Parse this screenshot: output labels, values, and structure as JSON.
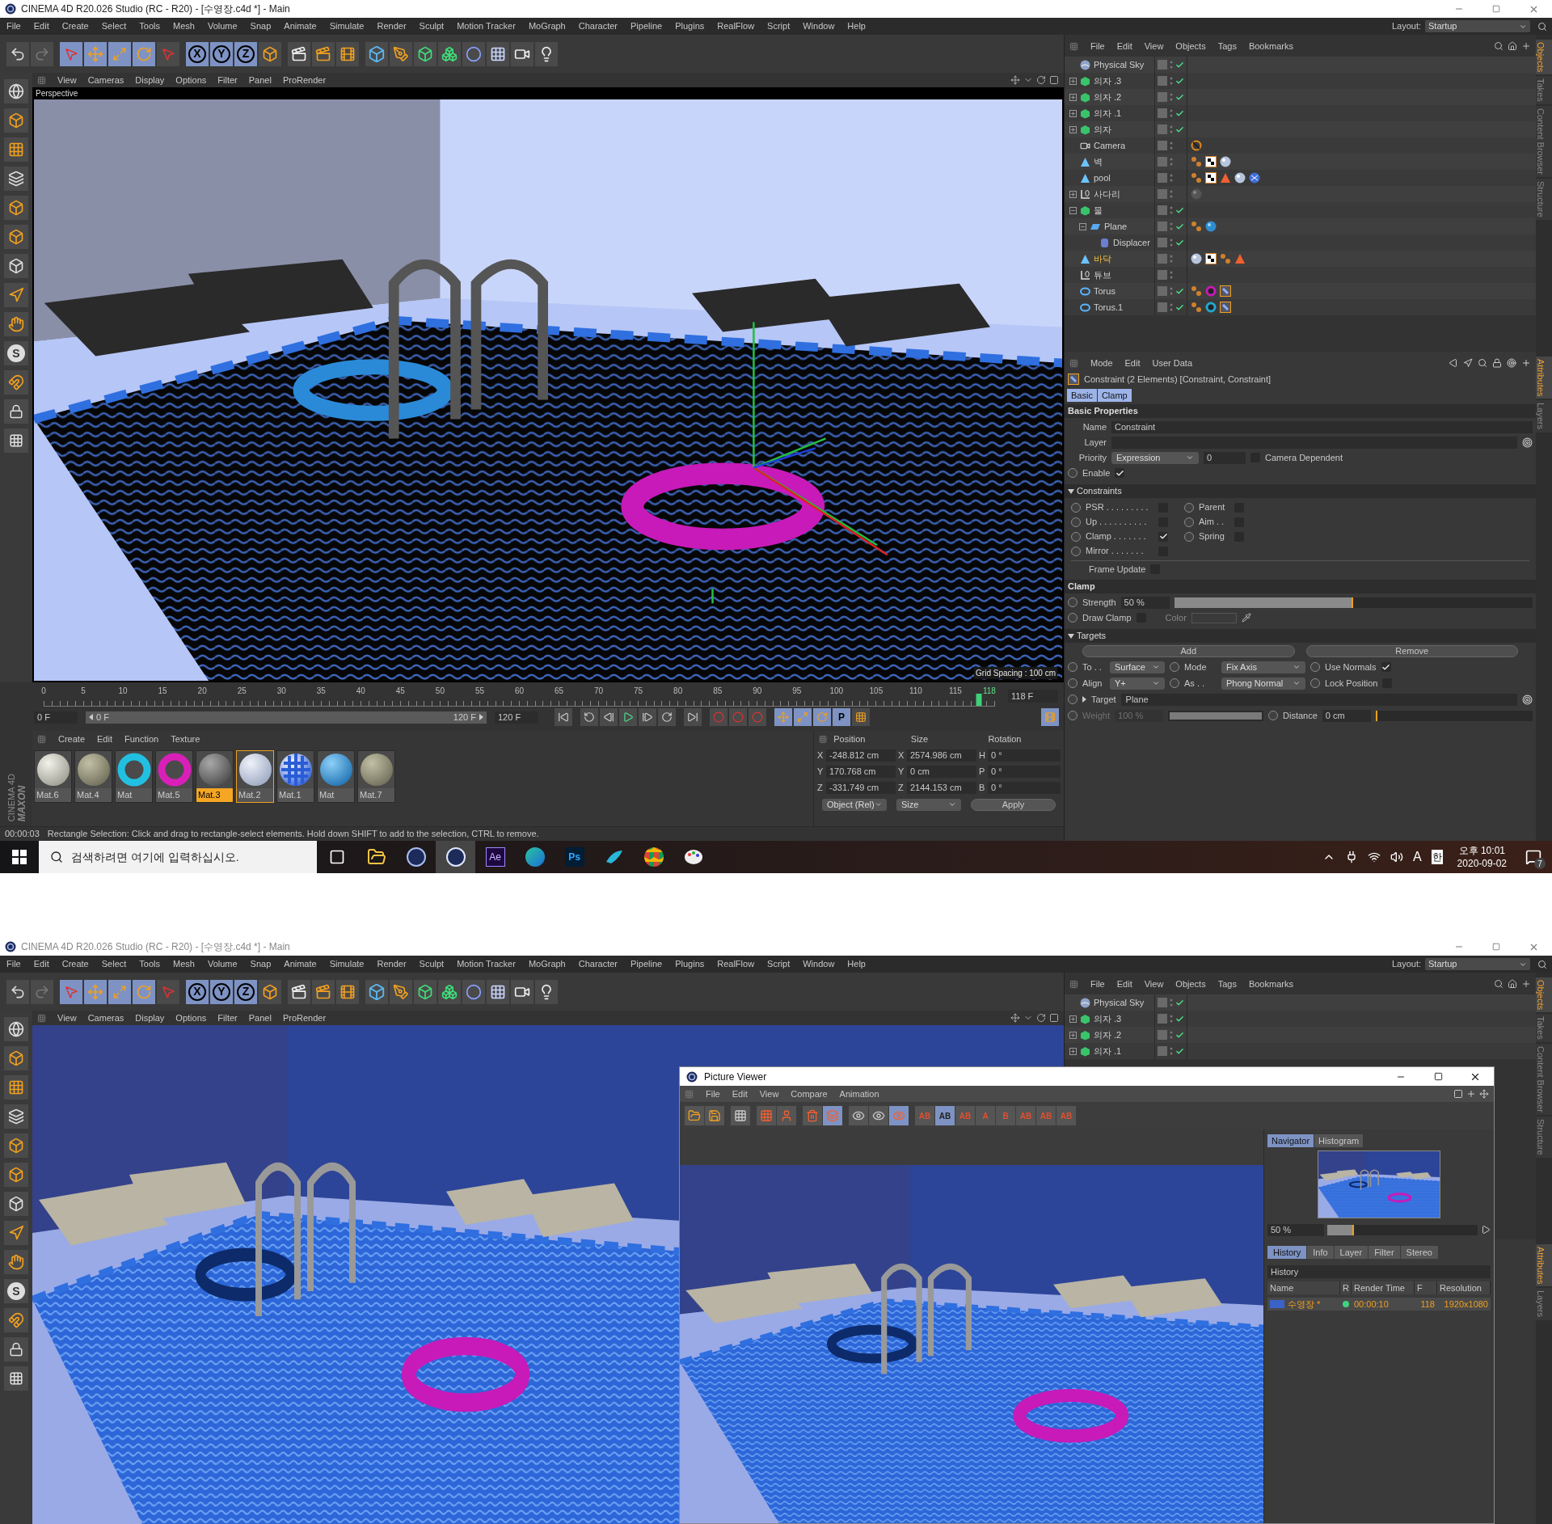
{
  "main_window": {
    "title": "CINEMA 4D R20.026 Studio (RC - R20) - [수영장.c4d *] - Main",
    "menu": [
      "File",
      "Edit",
      "Create",
      "Select",
      "Tools",
      "Mesh",
      "Volume",
      "Snap",
      "Animate",
      "Simulate",
      "Render",
      "Sculpt",
      "Motion Tracker",
      "MoGraph",
      "Character",
      "Pipeline",
      "Plugins",
      "RealFlow",
      "Script",
      "Window",
      "Help"
    ],
    "layout_label": "Layout:",
    "layout_value": "Startup",
    "axis_buttons": [
      "X",
      "Y",
      "Z"
    ],
    "tool_letter": "S",
    "viewport_menu": [
      "View",
      "Cameras",
      "Display",
      "Options",
      "Filter",
      "Panel",
      "ProRender"
    ],
    "viewport_label": "Perspective",
    "grid_spacing": "Grid Spacing : 100 cm",
    "objects": {
      "menu": [
        "File",
        "Edit",
        "View",
        "Objects",
        "Tags",
        "Bookmarks"
      ],
      "items": [
        {
          "name": "Physical Sky",
          "kind": "sky",
          "selected": false,
          "checked": true
        },
        {
          "name": "의자 .3",
          "kind": "group",
          "expanded": false,
          "selected": false,
          "checked": true
        },
        {
          "name": "의자 .2",
          "kind": "group",
          "expanded": false,
          "selected": false,
          "checked": true
        },
        {
          "name": "의자 .1",
          "kind": "group",
          "expanded": false,
          "selected": false,
          "checked": true
        },
        {
          "name": "의자",
          "kind": "group",
          "expanded": false,
          "selected": false,
          "checked": true
        },
        {
          "name": "Camera",
          "kind": "camera",
          "selected": false,
          "checked": false,
          "tags": [
            {
              "kind": "protection"
            }
          ]
        },
        {
          "name": "벽",
          "kind": "poly",
          "selected": false,
          "checked": false,
          "tags": [
            {
              "kind": "phong"
            },
            {
              "kind": "checker"
            },
            {
              "kind": "sphere"
            }
          ]
        },
        {
          "name": "pool",
          "kind": "poly",
          "selected": false,
          "checked": false,
          "tags": [
            {
              "kind": "phong"
            },
            {
              "kind": "checker"
            },
            {
              "kind": "triangle"
            },
            {
              "kind": "sphere"
            },
            {
              "kind": "checksphere"
            }
          ]
        },
        {
          "name": "사다리",
          "kind": "null",
          "expanded": false,
          "selected": false,
          "checked": false,
          "tags": [
            {
              "kind": "darksphere"
            }
          ]
        },
        {
          "name": "물",
          "kind": "group",
          "expanded": true,
          "selected": false,
          "checked": true,
          "children": [
            {
              "name": "Plane",
              "kind": "plane",
              "expanded": true,
              "selected": false,
              "checked": true,
              "tags": [
                {
                  "kind": "phong"
                },
                {
                  "kind": "glass"
                }
              ],
              "children": [
                {
                  "name": "Displacer",
                  "kind": "deformer",
                  "selected": false,
                  "checked": true
                }
              ]
            }
          ]
        },
        {
          "name": "바닥",
          "kind": "poly",
          "selected": true,
          "checked": false,
          "tags": [
            {
              "kind": "sphere"
            },
            {
              "kind": "checker"
            },
            {
              "kind": "phong"
            },
            {
              "kind": "triangle"
            }
          ]
        },
        {
          "name": "튜브",
          "kind": "null",
          "selected": false,
          "checked": false
        },
        {
          "name": "Torus",
          "kind": "torus",
          "selected": false,
          "checked": true,
          "tags": [
            {
              "kind": "phong"
            },
            {
              "kind": "pinkring"
            },
            {
              "kind": "constraint"
            }
          ]
        },
        {
          "name": "Torus.1",
          "kind": "torus",
          "selected": false,
          "checked": true,
          "tags": [
            {
              "kind": "phong"
            },
            {
              "kind": "cyanring"
            },
            {
              "kind": "constraint"
            }
          ]
        }
      ]
    },
    "side_tabs": [
      {
        "label": "Objects",
        "selected": true
      },
      {
        "label": "Takes",
        "selected": false
      },
      {
        "label": "Content Browser",
        "selected": false
      },
      {
        "label": "Structure",
        "selected": false
      }
    ],
    "attribute_side_tabs": [
      {
        "label": "Attributes",
        "selected": true
      },
      {
        "label": "Layers",
        "selected": false
      }
    ],
    "attributes": {
      "menu": [
        "Mode",
        "Edit",
        "User Data"
      ],
      "header": "Constraint (2 Elements) [Constraint, Constraint]",
      "tabs": [
        {
          "label": "Basic",
          "selected": true
        },
        {
          "label": "Clamp",
          "selected": true
        }
      ],
      "basic_title": "Basic Properties",
      "name_label": "Name",
      "name_value": "Constraint",
      "layer_label": "Layer",
      "priority_label": "Priority",
      "priority_value": "Expression",
      "priority_number": "0",
      "camera_dependent": {
        "label": "Camera Dependent",
        "checked": false
      },
      "enable": {
        "label": "Enable",
        "checked": true
      },
      "constraints_title": "Constraints",
      "constraints_left": [
        {
          "label": "PSR . . . . . . . . .",
          "checked": false
        },
        {
          "label": "Up . . . . . . . . . .",
          "checked": false
        },
        {
          "label": "Clamp . . . . . . .",
          "checked": true
        },
        {
          "label": "Mirror . . . . . . .",
          "checked": false
        }
      ],
      "constraints_right": [
        {
          "label": "Parent",
          "checked": false
        },
        {
          "label": "Aim . .",
          "checked": false
        },
        {
          "label": "Spring",
          "checked": false
        }
      ],
      "frame_update": {
        "label": "Frame Update",
        "checked": false
      },
      "clamp_title": "Clamp",
      "strength": {
        "label": "Strength",
        "value": "50 %",
        "level": 0.5
      },
      "draw_clamp": {
        "label": "Draw Clamp",
        "checked": false
      },
      "color_label": "Color",
      "targets_title": "Targets",
      "add": "Add",
      "remove": "Remove",
      "to": {
        "label": "To . .",
        "value": "Surface"
      },
      "mode": {
        "label": "Mode",
        "value": "Fix Axis"
      },
      "use_normals": {
        "label": "Use Normals",
        "checked": true
      },
      "align": {
        "label": "Align",
        "value": "Y+"
      },
      "as": {
        "label": "As . .",
        "value": "Phong Normal"
      },
      "lock_position": {
        "label": "Lock Position",
        "checked": false
      },
      "target": {
        "label": "Target",
        "value": "Plane"
      },
      "weight": {
        "label": "Weight",
        "value": "100 %",
        "level": 1,
        "disabled": true
      },
      "distance": {
        "label": "Distance",
        "value": "0 cm",
        "level": 0
      }
    },
    "timeline": {
      "ticks": [
        "0",
        "5",
        "10",
        "15",
        "20",
        "25",
        "30",
        "35",
        "40",
        "45",
        "50",
        "55",
        "60",
        "65",
        "70",
        "75",
        "80",
        "85",
        "90",
        "95",
        "100",
        "105",
        "110",
        "115"
      ],
      "current": "118",
      "level": 0.983,
      "end_field": "118 F"
    },
    "transport": {
      "start": "0 F",
      "range_start": "0 F",
      "range_end": "120 F",
      "level": 1,
      "end": "120 F",
      "key_label": "P"
    },
    "materials": {
      "menu": [
        "Create",
        "Edit",
        "Function",
        "Texture"
      ],
      "items": [
        {
          "name": "Mat.6",
          "kind": "white",
          "selected": false
        },
        {
          "name": "Mat.4",
          "kind": "tan",
          "selected": false
        },
        {
          "name": "Mat",
          "kind": "cyanring",
          "selected": false
        },
        {
          "name": "Mat.5",
          "kind": "pinkring",
          "selected": false
        },
        {
          "name": "Mat.3",
          "kind": "gray",
          "selected": true
        },
        {
          "name": "Mat.2",
          "kind": "pale",
          "selected": false,
          "outlined": true
        },
        {
          "name": "Mat.1",
          "kind": "checker",
          "selected": false
        },
        {
          "name": "Mat",
          "kind": "glass",
          "selected": false
        },
        {
          "name": "Mat.7",
          "kind": "tan",
          "selected": false
        }
      ]
    },
    "coordinates": {
      "headers": [
        "Position",
        "Size",
        "Rotation"
      ],
      "rows": [
        {
          "axis": "X",
          "position": "-248.812 cm",
          "size_axis": "X",
          "size": "2574.986 cm",
          "rotation_axis": "H",
          "rotation": "0 °"
        },
        {
          "axis": "Y",
          "position": "170.768 cm",
          "size_axis": "Y",
          "size": "0 cm",
          "rotation_axis": "P",
          "rotation": "0 °"
        },
        {
          "axis": "Z",
          "position": "-331.749 cm",
          "size_axis": "Z",
          "size": "2144.153 cm",
          "rotation_axis": "B",
          "rotation": "0 °"
        }
      ],
      "mode": "Object (Rel)",
      "size_mode": "Size",
      "apply": "Apply"
    },
    "status": {
      "time": "00:00:03",
      "message": "Rectangle Selection: Click and drag to rectangle-select elements. Hold down SHIFT to add to the selection, CTRL to remove."
    },
    "logo": [
      "MAXON",
      "CINEMA 4D"
    ]
  },
  "taskbar": {
    "search_placeholder": "검색하려면 여기에 입력하십시오.",
    "apps": [
      {
        "kind": "taskview"
      },
      {
        "kind": "explorer"
      },
      {
        "kind": "c4d"
      },
      {
        "kind": "c4d-active"
      },
      {
        "kind": "ae",
        "label": "Ae"
      },
      {
        "kind": "edge"
      },
      {
        "kind": "ps",
        "label": "Ps"
      },
      {
        "kind": "bird"
      },
      {
        "kind": "chrome"
      },
      {
        "kind": "paint"
      }
    ],
    "ime": "A",
    "lang": "한",
    "time": "오후 10:01",
    "date": "2020-09-02",
    "notifications": "7"
  },
  "second_window": {
    "title": "CINEMA 4D R20.026 Studio (RC - R20) - [수영장.c4d *] - Main",
    "menu": [
      "File",
      "Edit",
      "Create",
      "Select",
      "Tools",
      "Mesh",
      "Volume",
      "Snap",
      "Animate",
      "Simulate",
      "Render",
      "Sculpt",
      "Motion Tracker",
      "MoGraph",
      "Character",
      "Pipeline",
      "Plugins",
      "RealFlow",
      "Script",
      "Window",
      "Help"
    ],
    "layout_label": "Layout:",
    "layout_value": "Startup",
    "axis_buttons": [
      "X",
      "Y",
      "Z"
    ],
    "tool_letter": "S",
    "viewport_menu": [
      "View",
      "Cameras",
      "Display",
      "Options",
      "Filter",
      "Panel",
      "ProRender"
    ],
    "objects": {
      "menu": [
        "File",
        "Edit",
        "View",
        "Objects",
        "Tags",
        "Bookmarks"
      ],
      "items": [
        {
          "name": "Physical Sky",
          "kind": "sky",
          "selected": false,
          "checked": true
        },
        {
          "name": "의자 .3",
          "kind": "group",
          "expanded": false,
          "selected": false,
          "checked": true
        },
        {
          "name": "의자 .2",
          "kind": "group",
          "expanded": false,
          "selected": false,
          "checked": true
        },
        {
          "name": "의자 .1",
          "kind": "group",
          "expanded": false,
          "selected": false,
          "checked": true
        }
      ]
    },
    "side_tabs": [
      {
        "label": "Objects",
        "selected": true
      },
      {
        "label": "Takes",
        "selected": false
      },
      {
        "label": "Content Browser",
        "selected": false
      },
      {
        "label": "Structure",
        "selected": false
      }
    ],
    "attribute_side_tabs": [
      {
        "label": "Attributes",
        "selected": true
      },
      {
        "label": "Layers",
        "selected": false
      }
    ],
    "picture_viewer": {
      "title": "Picture Viewer",
      "menu": [
        "File",
        "Edit",
        "View",
        "Compare",
        "Animation"
      ],
      "compare_buttons": [
        {
          "label": "AB",
          "selected": false
        },
        {
          "label": "AB",
          "selected": true
        },
        {
          "label": "AB",
          "selected": false
        },
        {
          "label": "A",
          "selected": false
        },
        {
          "label": "B",
          "selected": false
        },
        {
          "label": "AB",
          "selected": false
        },
        {
          "label": "AB",
          "selected": false
        },
        {
          "label": "AB",
          "selected": false
        }
      ],
      "nav_tabs": [
        {
          "label": "Navigator",
          "selected": true
        },
        {
          "label": "Histogram",
          "selected": false
        }
      ],
      "zoom": {
        "value": "50 %",
        "level": 0.18
      },
      "panel_tabs": [
        {
          "label": "History",
          "selected": true
        },
        {
          "label": "Info",
          "selected": false
        },
        {
          "label": "Layer",
          "selected": false
        },
        {
          "label": "Filter",
          "selected": false
        },
        {
          "label": "Stereo",
          "selected": false
        }
      ],
      "history_title": "History",
      "columns": [
        "Name",
        "R",
        "Render Time",
        "F",
        "Resolution"
      ],
      "rows": [
        {
          "name": "수영장 *",
          "color": "#3fd27f",
          "time": "00:00:10",
          "frame": "118",
          "resolution": "1920x1080"
        }
      ]
    }
  }
}
